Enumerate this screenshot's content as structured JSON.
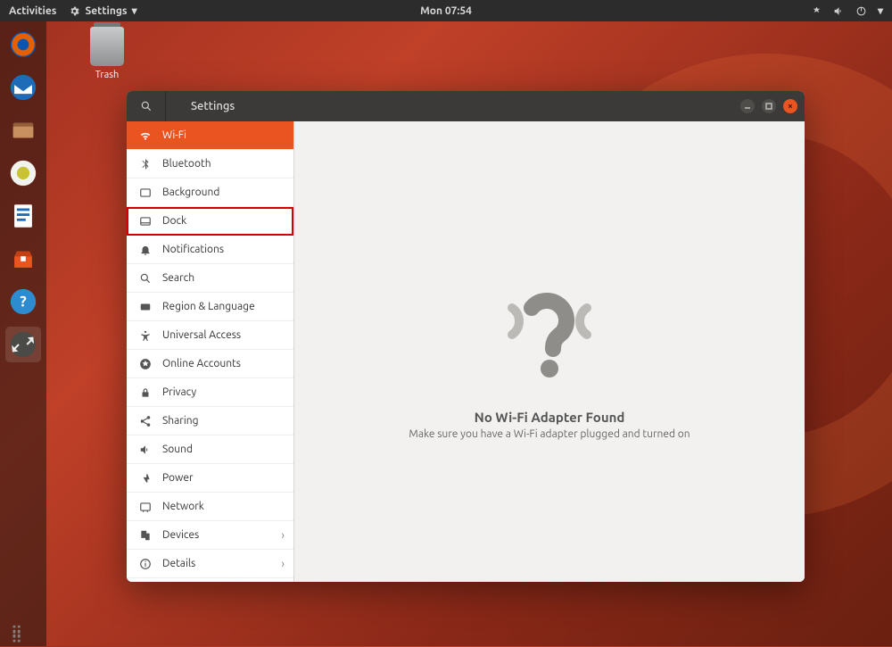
{
  "panel": {
    "activities": "Activities",
    "app_menu": "Settings",
    "clock": "Mon 07:54"
  },
  "desktop": {
    "trash_label": "Trash"
  },
  "window": {
    "title": "Settings",
    "controls": {
      "close": "×"
    }
  },
  "sidebar": {
    "items": [
      {
        "id": "wifi",
        "label": "Wi-Fi",
        "icon": "wifi",
        "selected": true
      },
      {
        "id": "bluetooth",
        "label": "Bluetooth",
        "icon": "bluetooth"
      },
      {
        "id": "background",
        "label": "Background",
        "icon": "background"
      },
      {
        "id": "dock",
        "label": "Dock",
        "icon": "dock",
        "highlighted": true
      },
      {
        "id": "notifications",
        "label": "Notifications",
        "icon": "bell"
      },
      {
        "id": "search",
        "label": "Search",
        "icon": "search"
      },
      {
        "id": "region",
        "label": "Region & Language",
        "icon": "region"
      },
      {
        "id": "universal",
        "label": "Universal Access",
        "icon": "universal"
      },
      {
        "id": "online",
        "label": "Online Accounts",
        "icon": "online"
      },
      {
        "id": "privacy",
        "label": "Privacy",
        "icon": "privacy"
      },
      {
        "id": "sharing",
        "label": "Sharing",
        "icon": "share"
      },
      {
        "id": "sound",
        "label": "Sound",
        "icon": "sound"
      },
      {
        "id": "power",
        "label": "Power",
        "icon": "power"
      },
      {
        "id": "network",
        "label": "Network",
        "icon": "network"
      },
      {
        "id": "devices",
        "label": "Devices",
        "icon": "devices",
        "chevron": true
      },
      {
        "id": "details",
        "label": "Details",
        "icon": "details",
        "chevron": true
      }
    ]
  },
  "content": {
    "heading": "No Wi-Fi Adapter Found",
    "subtext": "Make sure you have a Wi-Fi adapter plugged and turned on"
  },
  "dock_apps": [
    "firefox",
    "thunderbird",
    "files",
    "rhythmbox",
    "libreoffice",
    "software",
    "help",
    "settings"
  ]
}
